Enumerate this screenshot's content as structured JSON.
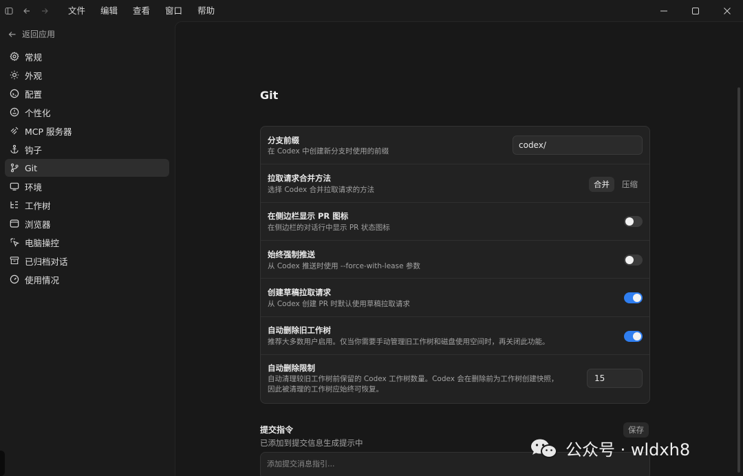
{
  "titlebar": {
    "menu": [
      "文件",
      "编辑",
      "查看",
      "窗口",
      "帮助"
    ]
  },
  "sidebar": {
    "back_label": "返回应用",
    "items": [
      {
        "label": "常规",
        "icon": "gear-icon"
      },
      {
        "label": "外观",
        "icon": "sun-icon"
      },
      {
        "label": "配置",
        "icon": "config-icon"
      },
      {
        "label": "个性化",
        "icon": "smile-icon"
      },
      {
        "label": "MCP 服务器",
        "icon": "mcp-icon"
      },
      {
        "label": "钩子",
        "icon": "anchor-icon"
      },
      {
        "label": "Git",
        "icon": "git-branch-icon"
      },
      {
        "label": "环境",
        "icon": "monitor-icon"
      },
      {
        "label": "工作树",
        "icon": "worktree-icon"
      },
      {
        "label": "浏览器",
        "icon": "browser-icon"
      },
      {
        "label": "电脑操控",
        "icon": "cursor-click-icon"
      },
      {
        "label": "已归档对话",
        "icon": "archive-icon"
      },
      {
        "label": "使用情况",
        "icon": "gauge-icon"
      }
    ],
    "active": "Git"
  },
  "main": {
    "title": "Git",
    "settings": {
      "branch_prefix": {
        "title": "分支前缀",
        "desc": "在 Codex 中创建新分支时使用的前缀",
        "value": "codex/"
      },
      "merge_method": {
        "title": "拉取请求合并方法",
        "desc": "选择 Codex 合并拉取请求的方法",
        "options": [
          "合并",
          "压缩"
        ],
        "selected": "合并"
      },
      "show_pr_icon": {
        "title": "在侧边栏显示 PR 图标",
        "desc": "在侧边栏的对话行中显示 PR 状态图标",
        "enabled": false
      },
      "force_push": {
        "title": "始终强制推送",
        "desc": "从 Codex 推送时使用 --force-with-lease 参数",
        "enabled": false
      },
      "draft_pr": {
        "title": "创建草稿拉取请求",
        "desc": "从 Codex 创建 PR 时默认使用草稿拉取请求",
        "enabled": true
      },
      "auto_delete": {
        "title": "自动删除旧工作树",
        "desc": "推荐大多数用户启用。仅当你需要手动管理旧工作树和磁盘使用空间时，再关闭此功能。",
        "enabled": true
      },
      "auto_delete_limit": {
        "title": "自动删除限制",
        "desc": "自动清理较旧工作树前保留的 Codex 工作树数量。Codex 会在删除前为工作树创建快照，因此被清理的工作树应始终可恢复。",
        "value": "15"
      }
    },
    "commit": {
      "title": "提交指令",
      "desc": "已添加到提交信息生成提示中",
      "save_label": "保存",
      "placeholder": "添加提交消息指引..."
    }
  },
  "watermark": {
    "text": "公众号 · wldxh8"
  },
  "colors": {
    "accent": "#2f7ef0",
    "panel": "#222222",
    "background": "#181818"
  }
}
